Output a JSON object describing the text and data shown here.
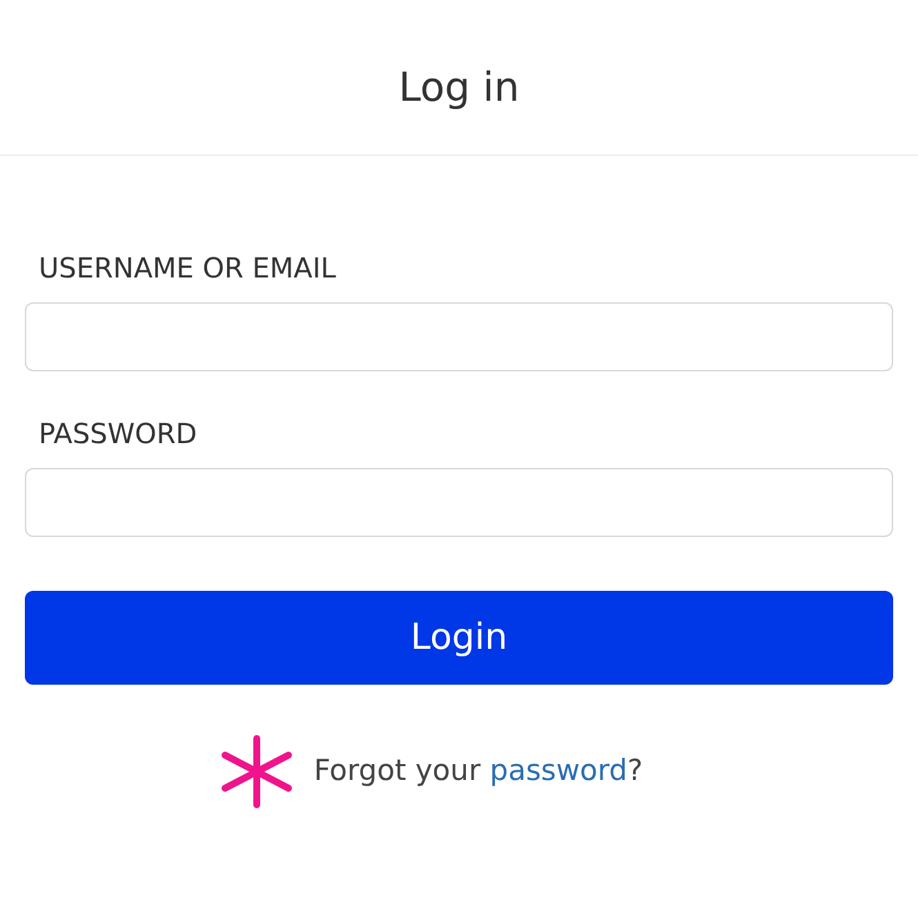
{
  "header": {
    "title": "Log in"
  },
  "fields": [
    {
      "label": "USERNAME OR EMAIL"
    },
    {
      "label": "PASSWORD"
    }
  ],
  "login_button": {
    "label": "Login"
  },
  "forgot": {
    "prefix": "Forgot your",
    "link": "password",
    "suffix": "?"
  }
}
